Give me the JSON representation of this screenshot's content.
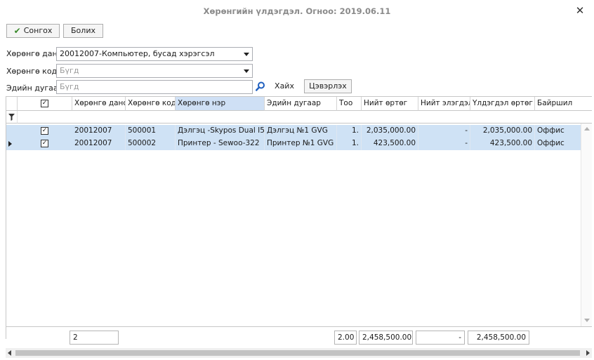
{
  "window": {
    "title": "Хөрөнгийн үлдэгдэл. Огноо: 2019.06.11"
  },
  "toolbar": {
    "select_label": "Сонгох",
    "cancel_label": "Болих"
  },
  "filters": {
    "account_label": "Хөрөнгө данс",
    "account_value": "20012007-Компьютер, бусад хэрэгсэл",
    "code_label": "Хөрөнгө код",
    "code_placeholder": "Бүгд",
    "owner_label": "Эдийн дугаар",
    "owner_placeholder": "Бүгд",
    "search_label": "Хайх",
    "clear_label": "Цэвэрлэх"
  },
  "grid": {
    "columns": [
      "Хөрөнгө данс",
      "Хөрөнгө код",
      "Хөрөнгө нэр",
      "Эдийн дугаар",
      "Тоо",
      "Нийт өртөг",
      "Нийт элэгдэл",
      "Үлдэгдэл өртөг",
      "Байршил"
    ],
    "rows": [
      {
        "checked": "✓",
        "account": "20012007",
        "code": "500001",
        "name": "Дэлгэц -Skypos Dual I5",
        "owner": "Дэлгэц №1 GVG",
        "qty": "1.",
        "total": "2,035,000.00",
        "depr": "-",
        "balance": "2,035,000.00",
        "location": "Оффис"
      },
      {
        "checked": "✓",
        "account": "20012007",
        "code": "500002",
        "name": "Принтер - Sewoo-322",
        "owner": "Принтер №1 GVG",
        "qty": "1.",
        "total": "423,500.00",
        "depr": "-",
        "balance": "423,500.00",
        "location": "Оффис"
      }
    ],
    "header_check": "✓",
    "footer": {
      "count": "2",
      "qty": "2.00",
      "total": "2,458,500.00",
      "depr": "-",
      "balance": "2,458,500.00"
    }
  }
}
